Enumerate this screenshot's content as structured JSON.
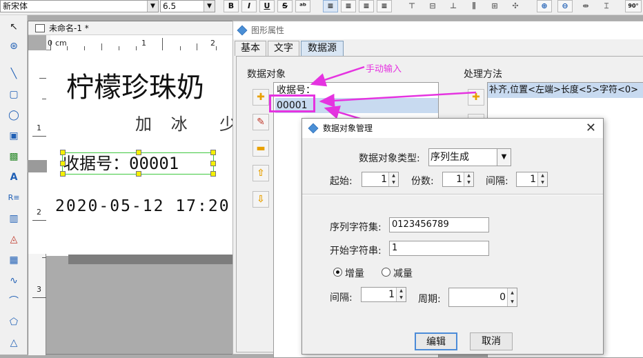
{
  "toolbar": {
    "font_name": "新宋体",
    "font_size": "6.5",
    "bold": "B",
    "italic": "I",
    "underline": "U",
    "strike": "S",
    "rotate_label": "90°"
  },
  "document": {
    "title": "未命名-1 *",
    "ruler_h": [
      "0",
      "cm",
      "1",
      "2"
    ],
    "ruler_v": [
      "1",
      "2",
      "3"
    ],
    "label_title": "柠檬珍珠奶",
    "label_sub": "加 冰",
    "label_sub2": "少",
    "label_barcode_text": "收据号：00001",
    "label_date": "2020-05-12 17:20"
  },
  "properties": {
    "title": "图形属性",
    "tabs": [
      "基本",
      "文字",
      "数据源"
    ],
    "selected_tab": "数据源",
    "data_objects_label": "数据对象",
    "data_items": [
      "收据号：",
      "00001"
    ],
    "process_label": "处理方法",
    "process_items": [
      "补齐,位置<左端>长度<5>字符<0>"
    ]
  },
  "annotation": {
    "text": "手动输入",
    "color": "#e533e0"
  },
  "manager": {
    "title": "数据对象管理",
    "type_label": "数据对象类型:",
    "type_value": "序列生成",
    "start_label": "起始:",
    "start_value": "1",
    "copies_label": "份数:",
    "copies_value": "1",
    "interval_label": "间隔:",
    "interval_value": "1",
    "charset_label": "序列字符集:",
    "charset_value": "0123456789",
    "start_str_label": "开始字符串:",
    "start_str_value": "1",
    "increment_label": "增量",
    "decrement_label": "减量",
    "increment_checked": true,
    "step_label": "间隔:",
    "step_value": "1",
    "period_label": "周期:",
    "period_value": "0",
    "edit_button": "编辑",
    "cancel_button": "取消"
  }
}
